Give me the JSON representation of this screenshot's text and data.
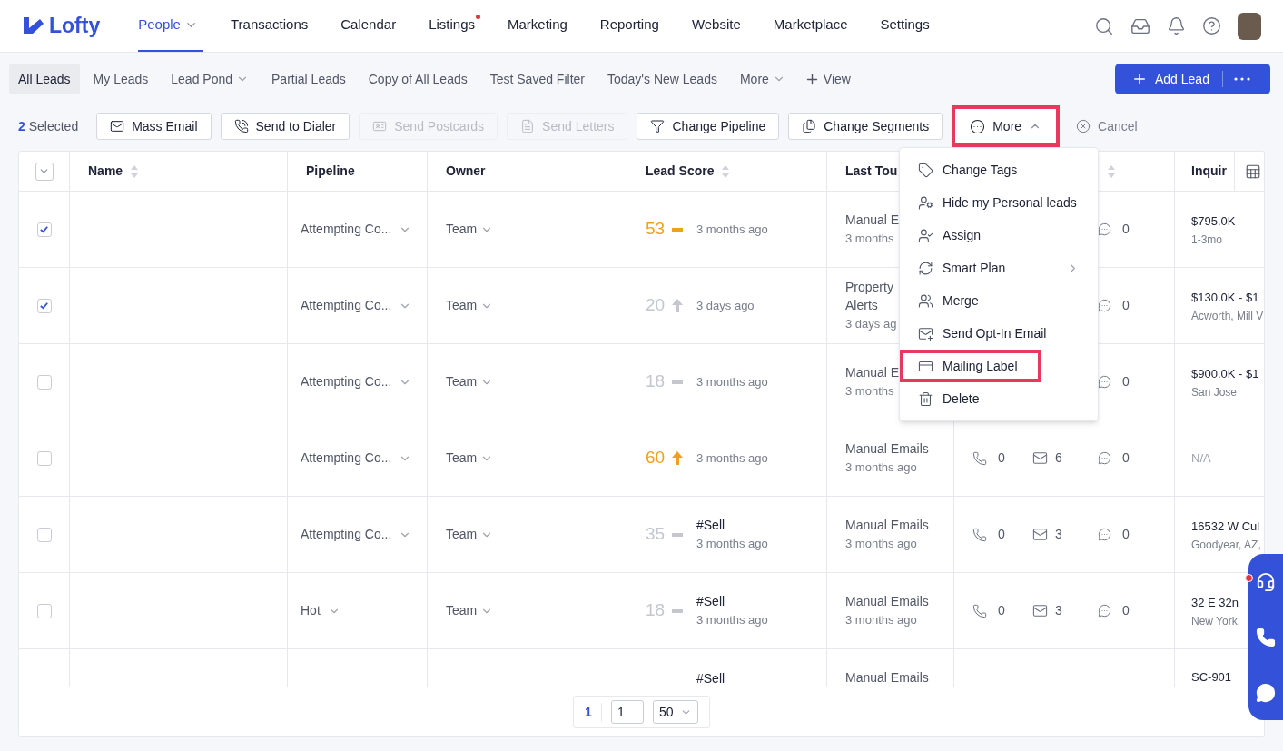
{
  "brand": {
    "name": "Lofty"
  },
  "nav": [
    {
      "label": "People",
      "selected": true,
      "dropdown": true,
      "dot": false
    },
    {
      "label": "Transactions",
      "selected": false,
      "dropdown": false,
      "dot": false
    },
    {
      "label": "Calendar",
      "selected": false,
      "dropdown": false,
      "dot": false
    },
    {
      "label": "Listings",
      "selected": false,
      "dropdown": false,
      "dot": true
    },
    {
      "label": "Marketing",
      "selected": false,
      "dropdown": false,
      "dot": false
    },
    {
      "label": "Reporting",
      "selected": false,
      "dropdown": false,
      "dot": false
    },
    {
      "label": "Website",
      "selected": false,
      "dropdown": false,
      "dot": false
    },
    {
      "label": "Marketplace",
      "selected": false,
      "dropdown": false,
      "dot": false
    },
    {
      "label": "Settings",
      "selected": false,
      "dropdown": false,
      "dot": false
    }
  ],
  "views": [
    {
      "label": "All Leads",
      "selected": true,
      "dropdown": false
    },
    {
      "label": "My Leads",
      "selected": false,
      "dropdown": false
    },
    {
      "label": "Lead Pond",
      "selected": false,
      "dropdown": true
    },
    {
      "label": "Partial Leads",
      "selected": false,
      "dropdown": false
    },
    {
      "label": "Copy of All Leads",
      "selected": false,
      "dropdown": false
    },
    {
      "label": "Test Saved Filter",
      "selected": false,
      "dropdown": false
    },
    {
      "label": "Today's New Leads",
      "selected": false,
      "dropdown": false
    },
    {
      "label": "More",
      "selected": false,
      "dropdown": true
    }
  ],
  "add_view": "View",
  "add_lead": "Add Lead",
  "selection": {
    "count": "2",
    "label": "Selected"
  },
  "actions": [
    {
      "kind": "mail",
      "label": "Mass Email",
      "disabled": false
    },
    {
      "kind": "dialer",
      "label": "Send to Dialer",
      "disabled": false
    },
    {
      "kind": "postcard",
      "label": "Send Postcards",
      "disabled": true
    },
    {
      "kind": "letter",
      "label": "Send Letters",
      "disabled": true
    },
    {
      "kind": "filter",
      "label": "Change Pipeline",
      "disabled": false
    },
    {
      "kind": "segments",
      "label": "Change Segments",
      "disabled": false
    }
  ],
  "more_button": {
    "label": "More",
    "expanded": true,
    "highlighted": true
  },
  "cancel": "Cancel",
  "menu": [
    {
      "kind": "tag",
      "label": "Change Tags",
      "submenu": false,
      "highlighted": false
    },
    {
      "kind": "hide",
      "label": "Hide my Personal leads",
      "submenu": false,
      "highlighted": false
    },
    {
      "kind": "assign",
      "label": "Assign",
      "submenu": false,
      "highlighted": false
    },
    {
      "kind": "plan",
      "label": "Smart Plan",
      "submenu": true,
      "highlighted": false
    },
    {
      "kind": "merge",
      "label": "Merge",
      "submenu": false,
      "highlighted": false
    },
    {
      "kind": "optin",
      "label": "Send Opt-In Email",
      "submenu": false,
      "highlighted": false
    },
    {
      "kind": "label",
      "label": "Mailing Label",
      "submenu": false,
      "highlighted": true
    },
    {
      "kind": "delete",
      "label": "Delete",
      "submenu": false,
      "highlighted": false
    }
  ],
  "table": {
    "columns": [
      {
        "label": "Name",
        "sortable": true
      },
      {
        "label": "Pipeline",
        "sortable": false
      },
      {
        "label": "Owner",
        "sortable": false
      },
      {
        "label": "Lead Score",
        "sortable": true
      },
      {
        "label": "Last Tou",
        "sortable": false
      },
      {
        "sortable": true
      },
      {
        "label": "Inquir",
        "sortable": false
      }
    ],
    "rows": [
      {
        "checked": true,
        "pipeline": "Attempting Co...",
        "owner": "Team",
        "score": {
          "value": "53",
          "color": "#f0a020",
          "rising": false,
          "time": "3 months ago"
        },
        "last_touch": {
          "title_lines": [
            "Manual E"
          ],
          "time": "3 months"
        },
        "comms": {
          "chats": "0"
        },
        "inquiry": {
          "price": "$795.0K",
          "sub": "1-3mo",
          "empty": false
        }
      },
      {
        "checked": true,
        "pipeline": "Attempting Co...",
        "owner": "Team",
        "score": {
          "value": "20",
          "color": "#c4c7d0",
          "rising": true,
          "time": "3 days ago"
        },
        "last_touch": {
          "title_lines": [
            "Property",
            "Alerts"
          ],
          "time": "3 days ag"
        },
        "comms": {
          "chats": "0"
        },
        "inquiry": {
          "price": "$130.0K - $1",
          "sub": "Acworth, Mill V",
          "empty": false
        }
      },
      {
        "checked": false,
        "pipeline": "Attempting Co...",
        "owner": "Team",
        "score": {
          "value": "18",
          "color": "#c4c7d0",
          "rising": false,
          "time": "3 months ago"
        },
        "last_touch": {
          "title_lines": [
            "Manual E"
          ],
          "time": "3 months"
        },
        "comms": {
          "chats": "0"
        },
        "inquiry": {
          "price": "$900.0K - $1",
          "sub": "San Jose",
          "empty": false
        }
      },
      {
        "checked": false,
        "pipeline": "Attempting Co...",
        "owner": "Team",
        "score": {
          "value": "60",
          "color": "#f0a020",
          "rising": true,
          "time": "3 months ago"
        },
        "last_touch": {
          "title_lines": [
            "Manual Emails"
          ],
          "time": "3 months ago"
        },
        "comms": {
          "calls": "0",
          "emails": "6",
          "chats": "0"
        },
        "inquiry": {
          "price": "N/A",
          "empty": true
        }
      },
      {
        "checked": false,
        "pipeline": "Attempting Co...",
        "owner": "Team",
        "score": {
          "value": "35",
          "color": "#c4c7d0",
          "rising": false,
          "tag": "#Sell",
          "time": "3 months ago"
        },
        "last_touch": {
          "title_lines": [
            "Manual Emails"
          ],
          "time": "3 months ago"
        },
        "comms": {
          "calls": "0",
          "emails": "3",
          "chats": "0"
        },
        "inquiry": {
          "price": "16532 W Cul",
          "sub": "Goodyear, AZ,",
          "empty": false
        }
      },
      {
        "checked": false,
        "pipeline": "Hot",
        "owner": "Team",
        "score": {
          "value": "18",
          "color": "#c4c7d0",
          "rising": false,
          "tag": "#Sell",
          "time": "3 months ago"
        },
        "last_touch": {
          "title_lines": [
            "Manual Emails"
          ],
          "time": "3 months ago"
        },
        "comms": {
          "calls": "0",
          "emails": "3",
          "chats": "0"
        },
        "inquiry": {
          "price": "32 E 32n",
          "sub": "New York,",
          "empty": false
        }
      },
      {
        "score": {
          "tag": "#Sell"
        },
        "last_touch": {
          "title_lines": [
            "Manual Emails"
          ]
        },
        "inquiry": {
          "price": "SC-901",
          "empty": false
        }
      }
    ]
  },
  "pagination": {
    "current": "1",
    "page_input": "1",
    "page_size": "50"
  },
  "widget": {
    "alert": true
  }
}
